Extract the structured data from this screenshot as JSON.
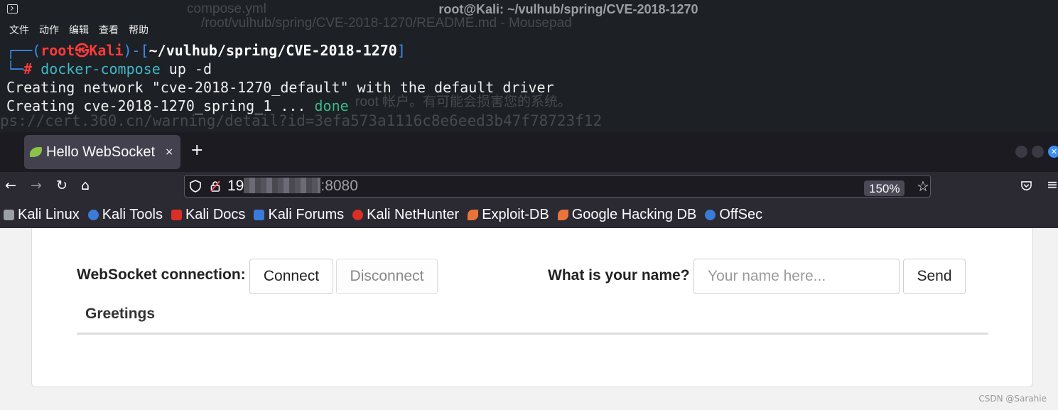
{
  "terminal": {
    "title": "root@Kali: ~/vulhub/spring/CVE-2018-1270",
    "menu": [
      "文件",
      "动作",
      "编辑",
      "查看",
      "帮助"
    ],
    "prompt_user": "root",
    "prompt_skull": "㉿",
    "prompt_host": "Kali",
    "prompt_path": "~/vulhub/spring/CVE-2018-1270",
    "prompt_hash": "#",
    "command": "docker-compose",
    "command_args": " up -d",
    "output_line1": "Creating network \"cve-2018-1270_default\" with the default driver",
    "output_line2": "Creating cve-2018-1270_spring_1 ... ",
    "output_done": "done",
    "bg_text": {
      "compose": "compose.yml",
      "readme": "/root/vulhub/spring/CVE-2018-1270/README.md - Mousepad",
      "warning": "root 帐户。有可能会损害您的系统。",
      "link": "ps://cert.360.cn/warning/detail?id=3efa573a1116c8e6eed3b47f78723f12"
    }
  },
  "browser": {
    "tab_title": "Hello WebSocket",
    "tab_close": "×",
    "new_tab": "+",
    "url_prefix": "19",
    "url_suffix": ":8080",
    "zoom": "150%",
    "bookmarks": [
      {
        "label": "Kali Linux",
        "color": "#9aa0a6"
      },
      {
        "label": "Kali Tools",
        "color": "#3b7bd8"
      },
      {
        "label": "Kali Docs",
        "color": "#d93025"
      },
      {
        "label": "Kali Forums",
        "color": "#3b7bd8"
      },
      {
        "label": "Kali NetHunter",
        "color": "#d93025"
      },
      {
        "label": "Exploit-DB",
        "color": "#e8743b"
      },
      {
        "label": "Google Hacking DB",
        "color": "#e8743b"
      },
      {
        "label": "OffSec",
        "color": "#3b7bd8"
      }
    ]
  },
  "page": {
    "ws_label": "WebSocket connection:",
    "connect": "Connect",
    "disconnect": "Disconnect",
    "name_label": "What is your name?",
    "name_placeholder": "Your name here...",
    "send": "Send",
    "greetings": "Greetings"
  },
  "watermark": "CSDN @Sarahie"
}
